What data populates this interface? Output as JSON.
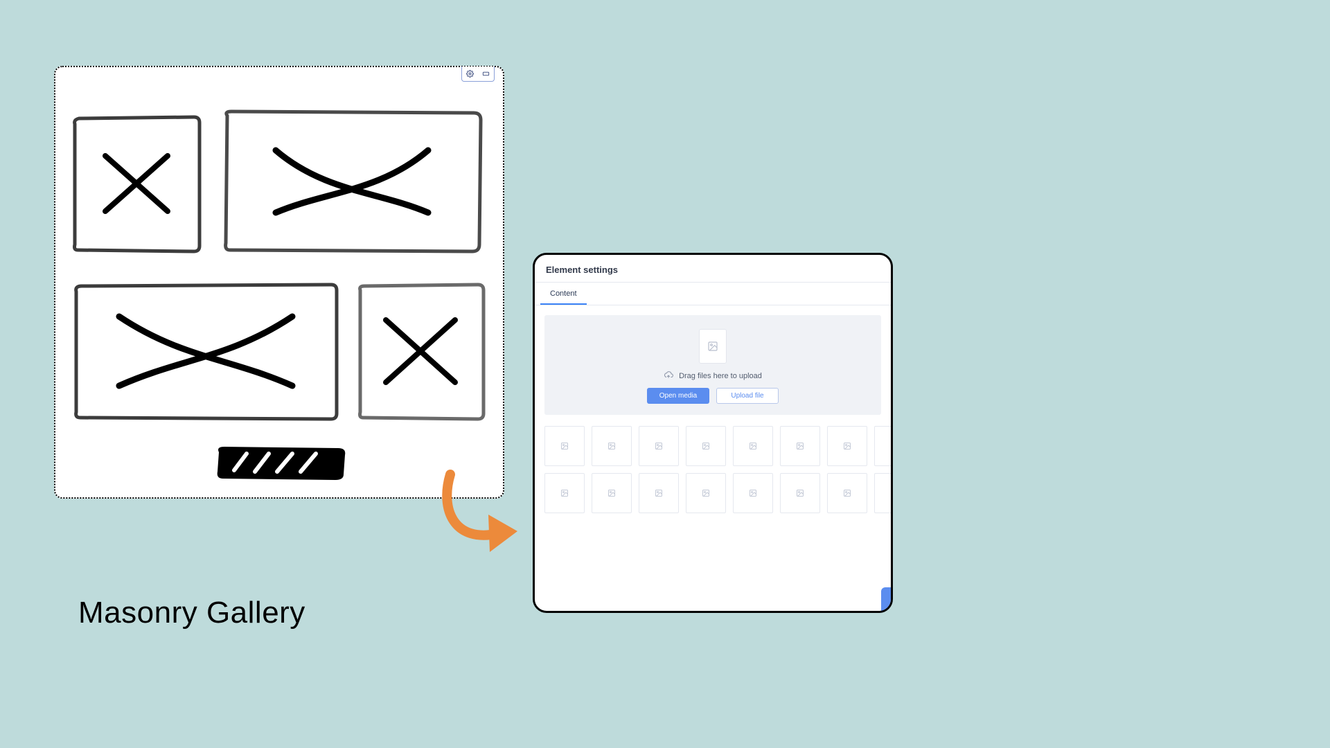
{
  "caption": "Masonry Gallery",
  "wireframe": {
    "toolbar": {
      "gear_icon": "gear",
      "expand_icon": "expand"
    }
  },
  "panel": {
    "title": "Element settings",
    "tabs": [
      {
        "label": "Content",
        "active": true
      }
    ],
    "dropzone": {
      "hint": "Drag files here to upload",
      "open_media_label": "Open media",
      "upload_file_label": "Upload file"
    },
    "thumbnails": {
      "rows": 2,
      "cols_full": 7
    }
  },
  "colors": {
    "bg": "#bedbdb",
    "accent": "#5b8def",
    "arrow": "#ec8a3b"
  }
}
